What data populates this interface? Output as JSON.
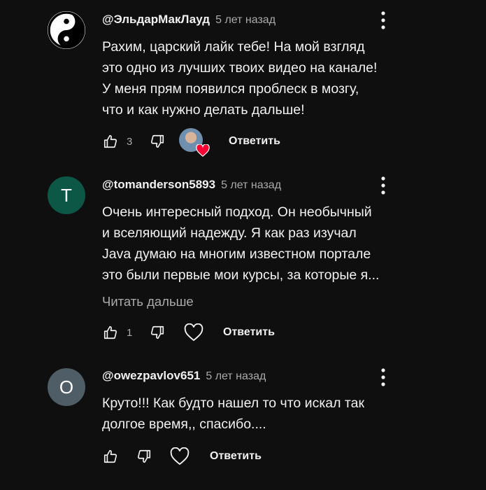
{
  "comments": [
    {
      "author": "@ЭльдарМакЛауд",
      "time": "5 лет назад",
      "avatar_icon": "yin-yang",
      "lines": [
        "Рахим, царский лайк тебе! На мой взгляд",
        "это одно из лучших твоих видео на канале!",
        "У меня прям появился проблеск в мозгу,",
        "что и как нужно делать дальше!"
      ],
      "likes": "3",
      "creator_heart": true,
      "reply_label": "Ответить"
    },
    {
      "author": "@tomanderson5893",
      "time": "5 лет назад",
      "avatar_letter": "T",
      "avatar_color": "#0c5746",
      "lines": [
        "Очень интересный подход. Он необычный",
        "и вселяющий надежду. Я как раз изучал",
        "Java думаю на многим известном портале",
        "это были первые мои курсы, за которые я..."
      ],
      "read_more": "Читать дальше",
      "likes": "1",
      "reply_label": "Ответить"
    },
    {
      "author": "@owezpavlov651",
      "time": "5 лет назад",
      "avatar_letter": "O",
      "avatar_color": "#4e5d66",
      "lines": [
        "Круто!!! Как будто нашел то что искал так",
        "долгое время,, спасибо...."
      ],
      "reply_label": "Ответить"
    }
  ]
}
